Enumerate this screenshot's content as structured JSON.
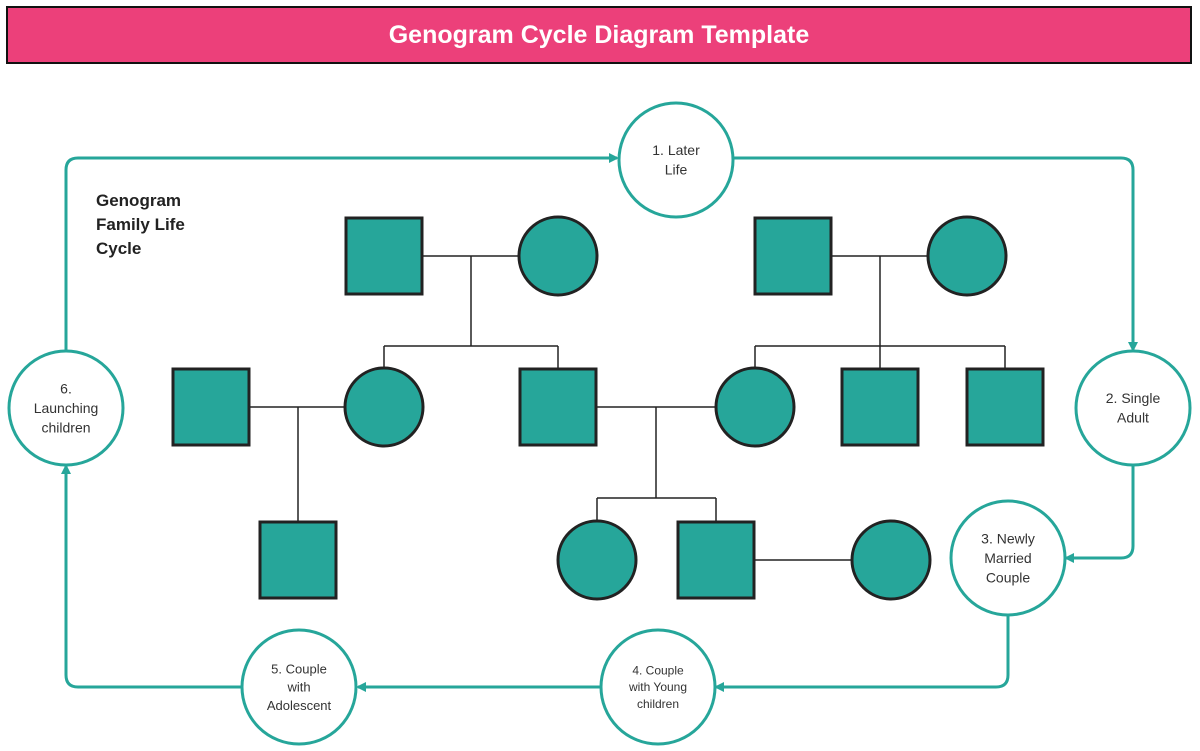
{
  "title": "Genogram Cycle Diagram Template",
  "side_label": [
    "Genogram",
    "Family Life",
    "Cycle"
  ],
  "colors": {
    "title_bg": "#ec407a",
    "accent": "#26a69a",
    "node_fill": "#26a69a",
    "node_stroke": "#222222",
    "line": "#222222"
  },
  "cycle_stages": [
    {
      "id": "later-life",
      "lines": [
        "1. Later",
        "Life"
      ]
    },
    {
      "id": "single-adult",
      "lines": [
        "2. Single",
        "Adult"
      ]
    },
    {
      "id": "newly-married-couple",
      "lines": [
        "3. Newly",
        "Married",
        "Couple"
      ]
    },
    {
      "id": "couple-with-young-children",
      "lines": [
        "4. Couple",
        "with Young",
        "children"
      ]
    },
    {
      "id": "couple-with-adolescent",
      "lines": [
        "5. Couple",
        "with",
        "Adolescent"
      ]
    },
    {
      "id": "launching-children",
      "lines": [
        "6.",
        "Launching",
        "children"
      ]
    }
  ],
  "genogram": {
    "generation_1": [
      {
        "gender": "male"
      },
      {
        "gender": "female"
      },
      {
        "gender": "male"
      },
      {
        "gender": "female"
      }
    ],
    "generation_2": [
      {
        "gender": "male"
      },
      {
        "gender": "female"
      },
      {
        "gender": "male"
      },
      {
        "gender": "female"
      },
      {
        "gender": "male"
      },
      {
        "gender": "male"
      }
    ],
    "generation_3": [
      {
        "gender": "male"
      },
      {
        "gender": "female"
      },
      {
        "gender": "male"
      },
      {
        "gender": "female"
      }
    ]
  }
}
